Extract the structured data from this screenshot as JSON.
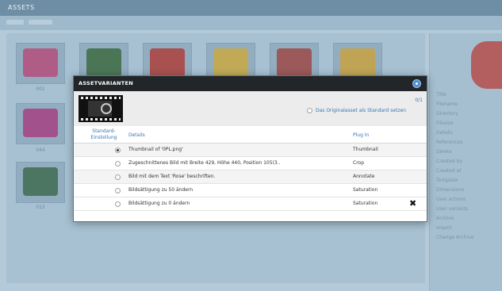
{
  "app": {
    "title": "ASSETS"
  },
  "thumbnails": [
    {
      "label": "001",
      "icon": "flower-pink-icon",
      "color": "#c2497a"
    },
    {
      "label": "",
      "icon": "plant-icon",
      "color": "#3c6b3a"
    },
    {
      "label": "",
      "icon": "flower-red-icon",
      "color": "#b83a32"
    },
    {
      "label": "",
      "icon": "flower-yellow-icon",
      "color": "#d8b13a"
    },
    {
      "label": "",
      "icon": "flower-red-icon",
      "color": "#a8443e"
    },
    {
      "label": "",
      "icon": "flower-yellow-icon",
      "color": "#d9a93a"
    },
    {
      "label": "044",
      "icon": "flower-magenta-icon",
      "color": "#b03a82"
    },
    {
      "label": "013",
      "icon": "leaf-icon",
      "color": "#3e6a4a"
    }
  ],
  "properties": {
    "labels": [
      "Title",
      "Filename",
      "Directory",
      "Filesize",
      "Details",
      "References",
      "Delete",
      "Created by",
      "Created at",
      "Template",
      "Dimensions",
      "User actions",
      "User variants",
      "Archive",
      "Import",
      "Change Archive"
    ]
  },
  "modal": {
    "title": "ASSETVARIANTEN",
    "counter": "0/1",
    "original_as_standard_label": "Das Originalasset als Standard setzen",
    "columns": {
      "standard": "Standard-Einstellung",
      "details": "Details",
      "plugin": "Plug In"
    },
    "rows": [
      {
        "details": "Thumbnail of '0PL.png'",
        "plugin": "Thumbnail",
        "checked": true
      },
      {
        "details": "Zugeschnittenes Bild mit Breite 429, Höhe 440, Position 105(3..",
        "plugin": "Crop",
        "checked": false
      },
      {
        "details": "Bild mit dem Text 'Rose' beschriften.",
        "plugin": "Annotate",
        "checked": false
      },
      {
        "details": "Bildsättigung zu 50 ändern",
        "plugin": "Saturation",
        "checked": false
      },
      {
        "details": "Bildsättigung zu 0 ändern",
        "plugin": "Saturation",
        "checked": false
      }
    ]
  }
}
